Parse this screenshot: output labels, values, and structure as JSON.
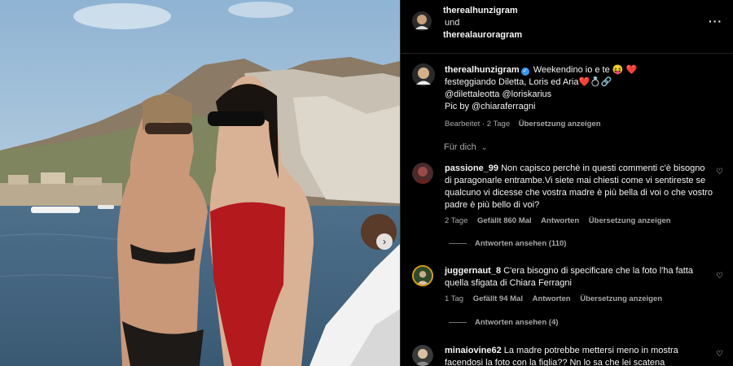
{
  "header": {
    "user1": "therealhunzigram",
    "connector": "und",
    "user2": "therealauroragram",
    "more_icon": "more-horizontal-icon"
  },
  "caption": {
    "username": "therealhunzigram",
    "line1": "Weekendino io e te 😝 ❤️",
    "line2": "festeggiando Diletta, Loris ed Aria❤️💍🔗",
    "line3": "@dilettaleotta @loriskarius",
    "line4": "Pic by @chiaraferragni",
    "edited": "Bearbeitet · 2 Tage",
    "translate": "Übersetzung anzeigen"
  },
  "for_you": "Für dich",
  "comments": [
    {
      "username": "passione_99",
      "text": "Non capisco perchè in questi commenti c'è bisogno di paragonarle entrambe.Vi siete mai chiesti come vi sentireste se qualcuno vi dicesse che vostra madre è più bella di voi o che vostro padre è più bello di voi?",
      "age": "2 Tage",
      "likes": "Gefällt 860 Mal",
      "reply": "Antworten",
      "translate": "Übersetzung anzeigen",
      "view_replies": "Antworten ansehen (110)"
    },
    {
      "username": "juggernaut_8",
      "text": "C'era bisogno di specificare che la foto l'ha fatta quella sfigata di Chiara Ferragni",
      "age": "1 Tag",
      "likes": "Gefällt 94 Mal",
      "reply": "Antworten",
      "translate": "Übersetzung anzeigen",
      "view_replies": "Antworten ansehen (4)"
    },
    {
      "username": "minaiovine62",
      "text": "La madre potrebbe mettersi meno in mostra facendosi la foto con la figlia?? Nn lo sa che lei scatena"
    }
  ],
  "colors": {
    "background": "#000000",
    "secondary_text": "#a8a8a8",
    "verified": "#3897f0",
    "heart": "#e0245e"
  }
}
